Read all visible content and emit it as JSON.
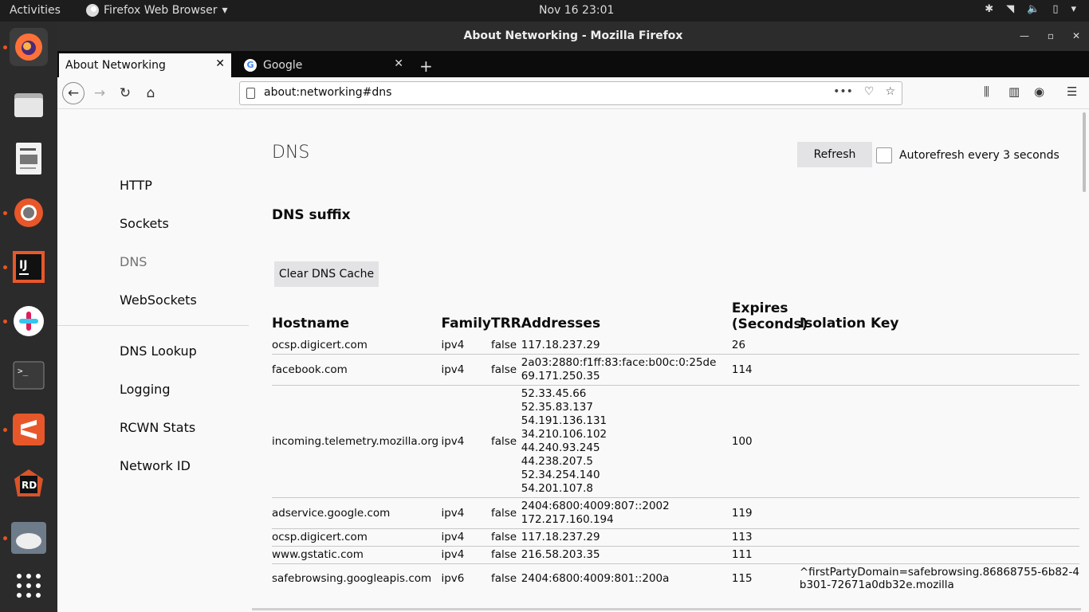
{
  "topbar": {
    "activities": "Activities",
    "app_name": "Firefox Web Browser",
    "clock": "Nov 16  23:01"
  },
  "window": {
    "title": "About Networking - Mozilla Firefox"
  },
  "tabs": [
    {
      "label": "About Networking"
    },
    {
      "label": "Google"
    }
  ],
  "url": "about:networking#dns",
  "sidebar": {
    "items": [
      "HTTP",
      "Sockets",
      "DNS",
      "WebSockets",
      "DNS Lookup",
      "Logging",
      "RCWN Stats",
      "Network ID"
    ]
  },
  "main": {
    "title": "DNS",
    "refresh_label": "Refresh",
    "autorefresh_label": "Autorefresh every 3 seconds",
    "suffix_heading": "DNS suffix",
    "clear_label": "Clear DNS Cache",
    "columns": [
      "Hostname",
      "Family",
      "TRR",
      "Addresses",
      "Expires (Seconds)",
      "Isolation Key"
    ],
    "rows": [
      {
        "host": "ocsp.digicert.com",
        "family": "ipv4",
        "trr": "false",
        "addresses": [
          "117.18.237.29"
        ],
        "expires": "26",
        "iso": ""
      },
      {
        "host": "facebook.com",
        "family": "ipv4",
        "trr": "false",
        "addresses": [
          "2a03:2880:f1ff:83:face:b00c:0:25de",
          "69.171.250.35"
        ],
        "expires": "114",
        "iso": ""
      },
      {
        "host": "incoming.telemetry.mozilla.org",
        "family": "ipv4",
        "trr": "false",
        "addresses": [
          "52.33.45.66",
          "52.35.83.137",
          "54.191.136.131",
          "34.210.106.102",
          "44.240.93.245",
          "44.238.207.5",
          "52.34.254.140",
          "54.201.107.8"
        ],
        "expires": "100",
        "iso": ""
      },
      {
        "host": "adservice.google.com",
        "family": "ipv4",
        "trr": "false",
        "addresses": [
          "2404:6800:4009:807::2002",
          "172.217.160.194"
        ],
        "expires": "119",
        "iso": ""
      },
      {
        "host": "ocsp.digicert.com",
        "family": "ipv4",
        "trr": "false",
        "addresses": [
          "117.18.237.29"
        ],
        "expires": "113",
        "iso": ""
      },
      {
        "host": "www.gstatic.com",
        "family": "ipv4",
        "trr": "false",
        "addresses": [
          "216.58.203.35"
        ],
        "expires": "111",
        "iso": ""
      },
      {
        "host": "safebrowsing.googleapis.com",
        "family": "ipv6",
        "trr": "false",
        "addresses": [
          "2404:6800:4009:801::200a"
        ],
        "expires": "115",
        "iso": "^firstPartyDomain=safebrowsing.86868755-6b82-4\nb301-72671a0db32e.mozilla"
      }
    ]
  }
}
